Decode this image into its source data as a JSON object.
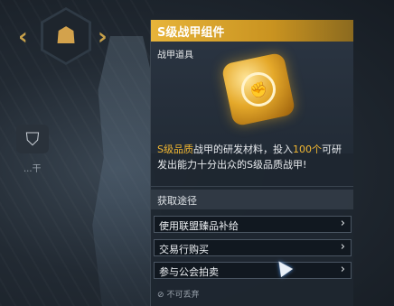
{
  "background": {
    "side_icon": "helmet-icon",
    "side_label": "...干"
  },
  "panel": {
    "title": "S级战甲组件",
    "item_type": "战甲道具",
    "item_icon": "armor-component-icon",
    "description": {
      "hl1": "S级品质",
      "text1": "战甲的研发材料，投入",
      "hl2": "100个",
      "text2": "可研发出能力十分出众的S级品质战甲!"
    },
    "acquire_label": "获取途径",
    "sources": [
      {
        "label": "使用联盟臻品补给"
      },
      {
        "label": "交易行购买"
      },
      {
        "label": "参与公会拍卖"
      }
    ],
    "footer": "不可丢弃"
  },
  "colors": {
    "accent": "#e7b43a",
    "highlight": "#f2b731"
  }
}
